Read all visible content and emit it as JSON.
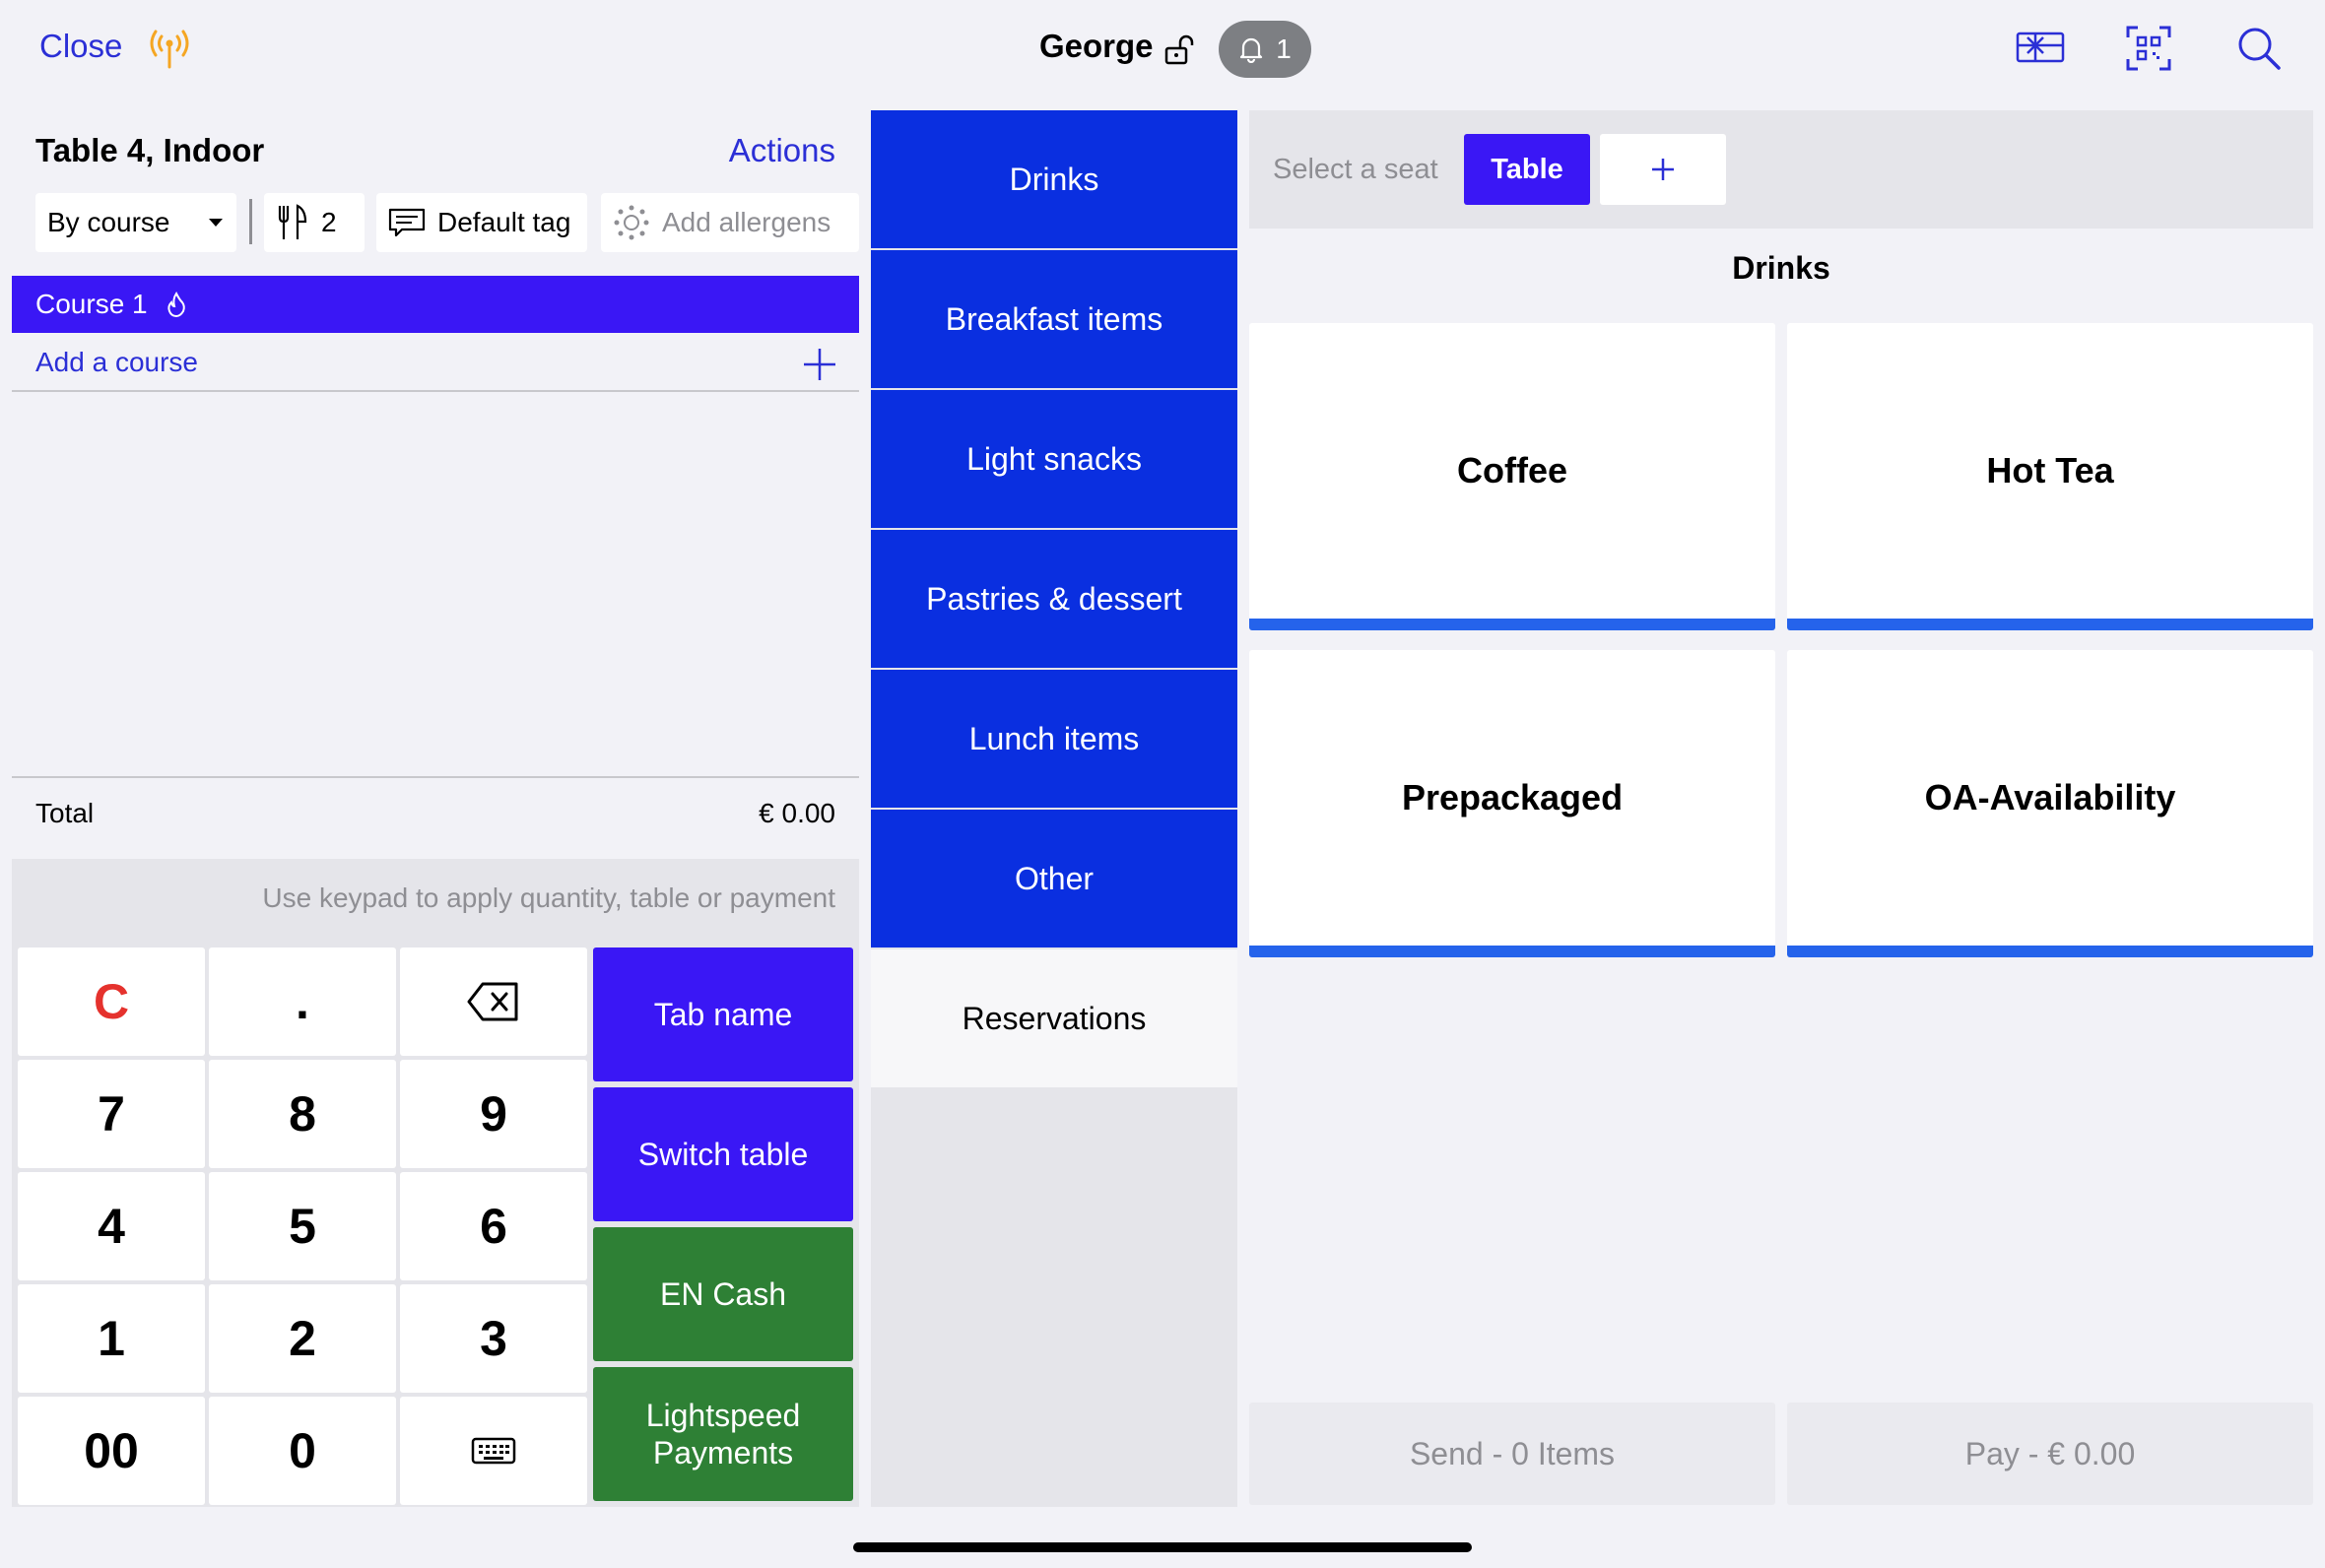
{
  "header": {
    "close_label": "Close",
    "user_name": "George",
    "notification_count": "1",
    "icons": [
      "antenna-icon",
      "unlock-icon",
      "bell-icon",
      "gift-card-icon",
      "qr-scan-icon",
      "search-icon"
    ]
  },
  "order": {
    "title": "Table 4, Indoor",
    "actions_label": "Actions",
    "course_mode": "By course",
    "guest_count": "2",
    "tag": "Default tag",
    "allergens_placeholder": "Add allergens",
    "courses": [
      {
        "label": "Course 1"
      }
    ],
    "add_course_label": "Add a course",
    "total_label": "Total",
    "total_value": "€ 0.00"
  },
  "keypad": {
    "hint": "Use keypad to apply quantity, table or payment",
    "keys": {
      "clear": "C",
      "dot": ".",
      "k7": "7",
      "k8": "8",
      "k9": "9",
      "k4": "4",
      "k5": "5",
      "k6": "6",
      "k1": "1",
      "k2": "2",
      "k3": "3",
      "k00": "00",
      "k0": "0"
    },
    "actions": {
      "tab_name": "Tab name",
      "switch_table": "Switch table",
      "cash": "EN Cash",
      "lightspeed": "Lightspeed Payments"
    }
  },
  "categories": [
    {
      "label": "Drinks"
    },
    {
      "label": "Breakfast items"
    },
    {
      "label": "Light snacks"
    },
    {
      "label": "Pastries & dessert"
    },
    {
      "label": "Lunch items"
    },
    {
      "label": "Other"
    },
    {
      "label": "Reservations"
    }
  ],
  "seats": {
    "select_label": "Select a seat",
    "table_label": "Table"
  },
  "products": {
    "section_title": "Drinks",
    "items": [
      {
        "label": "Coffee"
      },
      {
        "label": "Hot Tea"
      },
      {
        "label": "Prepackaged"
      },
      {
        "label": "OA-Availability"
      }
    ]
  },
  "footer": {
    "send_label": "Send - 0 Items",
    "pay_label": "Pay - € 0.00"
  },
  "colors": {
    "accent_blue": "#3a17f5",
    "category_blue": "#0a2fe0",
    "pay_green": "#2e8035",
    "link_blue": "#2b2fd6",
    "product_bar": "#2563eb"
  }
}
